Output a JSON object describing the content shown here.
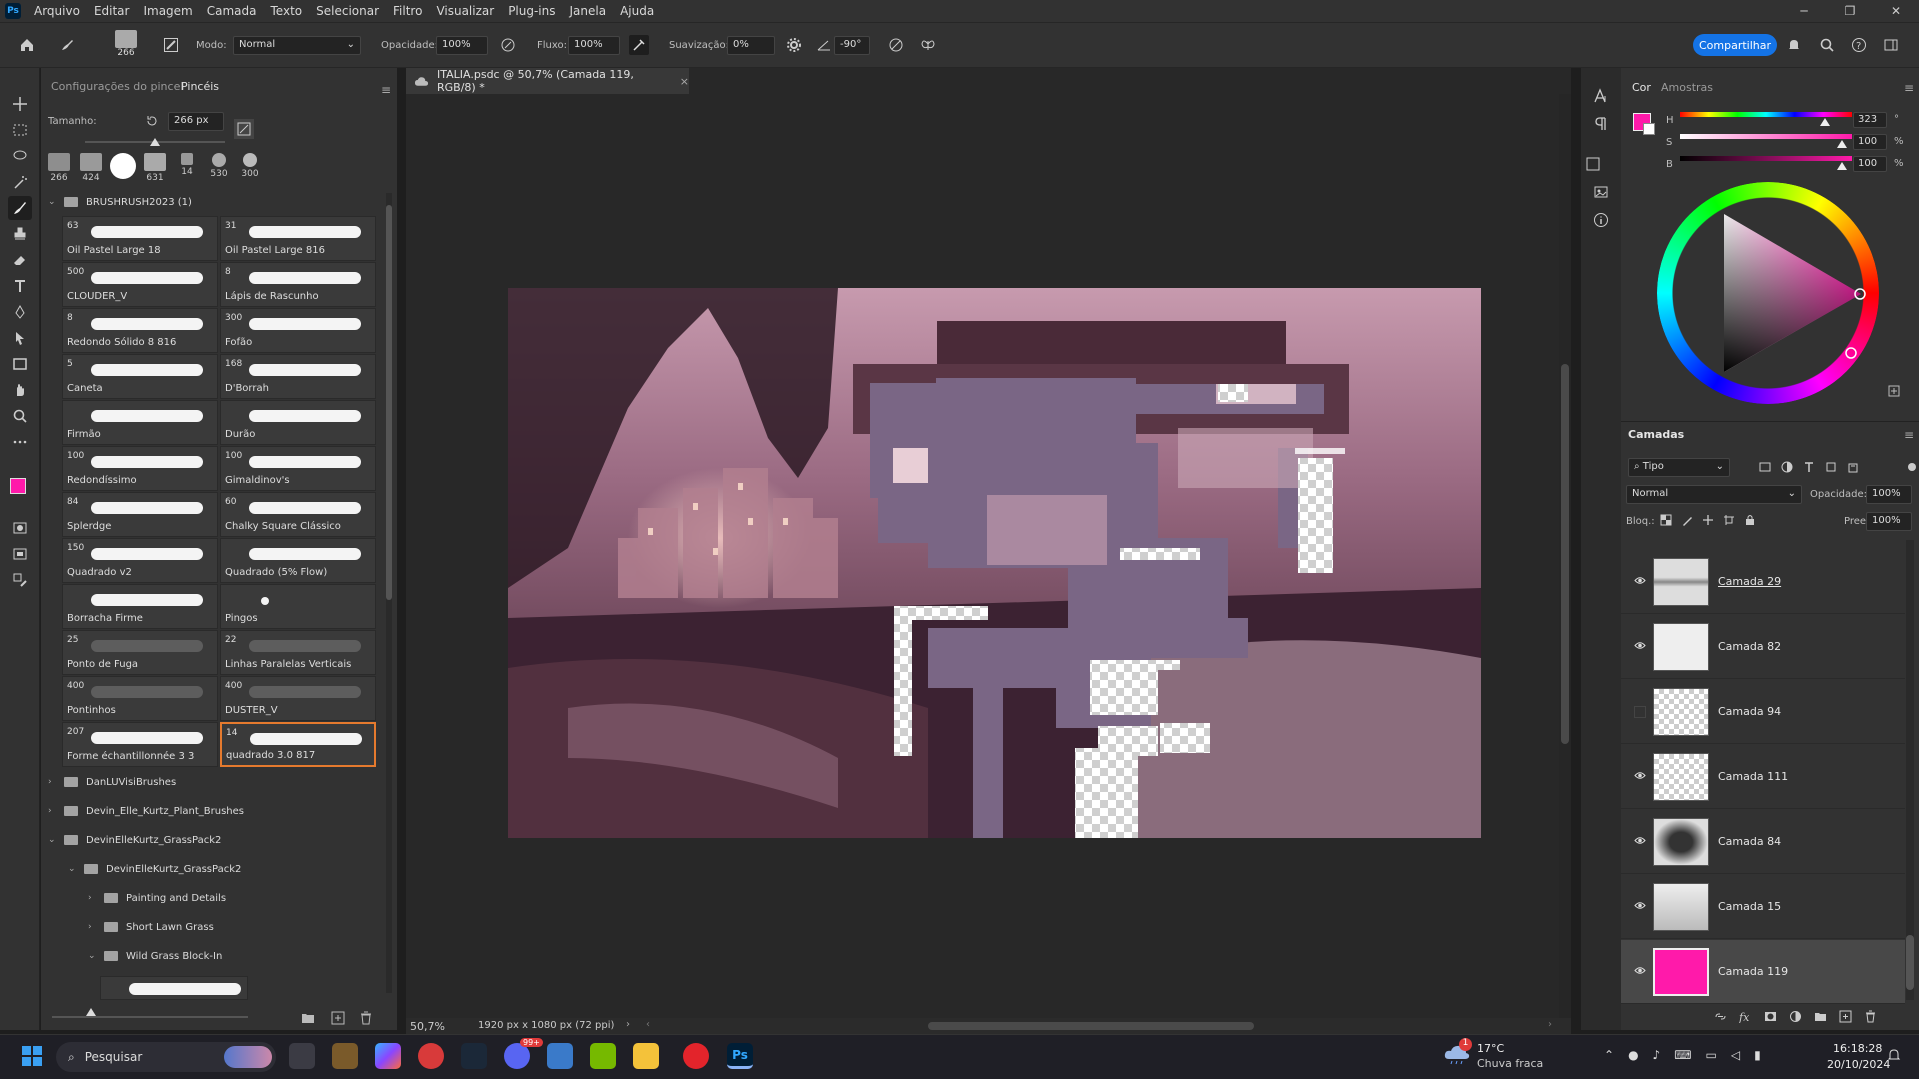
{
  "menu": [
    "Arquivo",
    "Editar",
    "Imagem",
    "Camada",
    "Texto",
    "Selecionar",
    "Filtro",
    "Visualizar",
    "Plug-ins",
    "Janela",
    "Ajuda"
  ],
  "app_logo": "Ps",
  "options": {
    "brush_size_badge": "266",
    "mode_label": "Modo:",
    "mode_value": "Normal",
    "opacity_label": "Opacidade:",
    "opacity_value": "100%",
    "flow_label": "Fluxo:",
    "flow_value": "100%",
    "smoothing_label": "Suavização:",
    "smoothing_value": "0%",
    "angle_value": "-90°",
    "share_label": "Compartilhar"
  },
  "brush_panel": {
    "tab_settings": "Configurações do pincel",
    "tab_brushes": "Pincéis",
    "size_label": "Tamanho:",
    "size_value": "266 px",
    "size_slider_fraction": 0.5,
    "presets": [
      "266",
      "424",
      "",
      "631",
      "14",
      "530",
      "300"
    ],
    "group_title": "BRUSHRUSH2023 (1)",
    "brushes": [
      {
        "size": "63",
        "name": "Oil Pastel Large 18"
      },
      {
        "size": "31",
        "name": "Oil Pastel Large 816"
      },
      {
        "size": "500",
        "name": "CLOUDER_V"
      },
      {
        "size": "8",
        "name": "Lápis de Rascunho"
      },
      {
        "size": "8",
        "name": "Redondo Sólido 8 816"
      },
      {
        "size": "300",
        "name": "Fofão"
      },
      {
        "size": "5",
        "name": "Caneta"
      },
      {
        "size": "168",
        "name": "D'Borrah"
      },
      {
        "size": "",
        "name": "Firmão"
      },
      {
        "size": "",
        "name": "Durão"
      },
      {
        "size": "100",
        "name": "Redondíssimo"
      },
      {
        "size": "100",
        "name": "Gimaldinov's"
      },
      {
        "size": "84",
        "name": "Splerdge"
      },
      {
        "size": "60",
        "name": "Chalky Square Clássico"
      },
      {
        "size": "150",
        "name": "Quadrado v2"
      },
      {
        "size": "",
        "name": "Quadrado (5% Flow)"
      },
      {
        "size": "",
        "name": "Borracha Firme"
      },
      {
        "size": "",
        "name": "Pingos"
      },
      {
        "size": "25",
        "name": "Ponto de Fuga"
      },
      {
        "size": "22",
        "name": "Linhas Paralelas Verticais"
      },
      {
        "size": "400",
        "name": "Pontinhos"
      },
      {
        "size": "400",
        "name": "DUSTER_V"
      },
      {
        "size": "207",
        "name": "Forme échantillonnée 3 3"
      },
      {
        "size": "14",
        "name": "quadrado 3.0 817"
      }
    ],
    "folders": [
      {
        "name": "DanLUVisiBrushes",
        "level": 0,
        "open": false
      },
      {
        "name": "Devin_Elle_Kurtz_Plant_Brushes",
        "level": 0,
        "open": false
      },
      {
        "name": "DevinElleKurtz_GrassPack2",
        "level": 0,
        "open": true
      },
      {
        "name": "DevinElleKurtz_GrassPack2",
        "level": 1,
        "open": true
      },
      {
        "name": "Painting and Details",
        "level": 2,
        "open": false
      },
      {
        "name": "Short Lawn Grass",
        "level": 2,
        "open": false
      },
      {
        "name": "Wild Grass Block-In",
        "level": 2,
        "open": true
      }
    ]
  },
  "document": {
    "tab_title": "ITALIA.psdc @ 50,7% (Camada 119, RGB/8) *",
    "zoom": "50,7%",
    "doc_size": "1920 px x 1080 px (72 ppi)"
  },
  "color_panel": {
    "tab_color": "Cor",
    "tab_swatches": "Amostras",
    "h_label": "H",
    "s_label": "S",
    "b_label": "B",
    "h_value": "323",
    "s_value": "100",
    "b_value": "100",
    "h_unit": "°",
    "s_unit": "%",
    "b_unit": "%",
    "foreground": "#ff1aaa"
  },
  "layers_panel": {
    "title": "Camadas",
    "filter_value": "Tipo",
    "blend_mode": "Normal",
    "opacity_label": "Opacidade:",
    "opacity_value": "100%",
    "lock_label": "Bloq.:",
    "fill_label": "Preen.:",
    "fill_value": "100%",
    "layers": [
      {
        "name": "Camada 29",
        "visible": true,
        "selected": false
      },
      {
        "name": "Camada 82",
        "visible": true,
        "selected": false
      },
      {
        "name": "Camada 94",
        "visible": false,
        "selected": false
      },
      {
        "name": "Camada 111",
        "visible": true,
        "selected": false
      },
      {
        "name": "Camada 84",
        "visible": true,
        "selected": false
      },
      {
        "name": "Camada 15",
        "visible": true,
        "selected": false
      },
      {
        "name": "Camada 119",
        "visible": true,
        "selected": true
      }
    ]
  },
  "taskbar": {
    "search_placeholder": "Pesquisar",
    "weather_temp": "17°C",
    "weather_desc": "Chuva fraca",
    "time": "16:18:28",
    "date": "20/10/2024",
    "notification_count": "1",
    "discord_badge": "99+"
  }
}
